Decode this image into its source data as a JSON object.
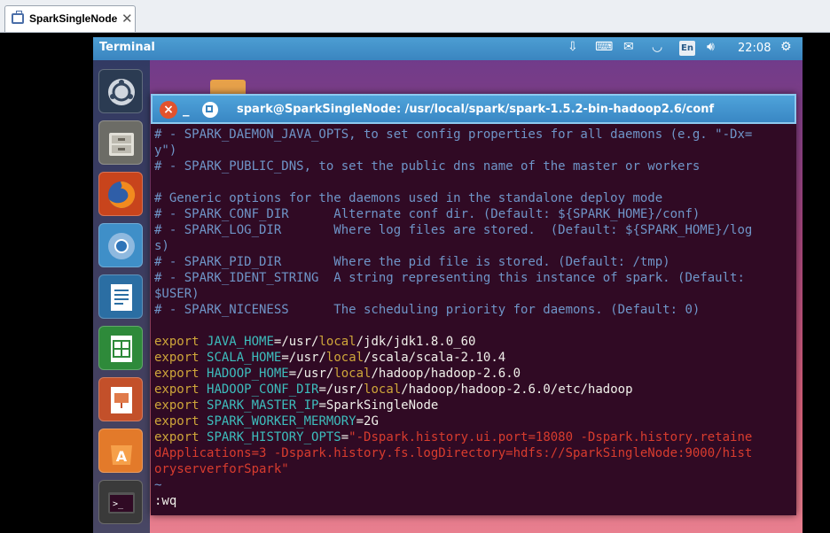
{
  "host": {
    "tab_title": "SparkSingleNode",
    "tab_close": "✕"
  },
  "topbar": {
    "app_title": "Terminal",
    "language": "En",
    "clock": "22:08"
  },
  "launcher": {
    "items": [
      {
        "icon": "ubuntu-dash-icon"
      },
      {
        "icon": "file-manager-icon"
      },
      {
        "icon": "firefox-icon"
      },
      {
        "icon": "chromium-icon"
      },
      {
        "icon": "libreoffice-writer-icon"
      },
      {
        "icon": "libreoffice-calc-icon"
      },
      {
        "icon": "libreoffice-impress-icon"
      },
      {
        "icon": "software-center-icon"
      },
      {
        "icon": "terminal-icon"
      }
    ]
  },
  "terminal": {
    "title": "spark@SparkSingleNode: /usr/local/spark/spark-1.5.2-bin-hadoop2.6/conf",
    "lines": [
      {
        "c": "# - SPARK_DAEMON_JAVA_OPTS, to set config properties for all daemons (e.g. \"-Dx=",
        "cls": "com"
      },
      {
        "c": "y\")",
        "cls": "com"
      },
      {
        "c": "# - SPARK_PUBLIC_DNS, to set the public dns name of the master or workers",
        "cls": "com"
      },
      {
        "c": "",
        "cls": "com"
      },
      {
        "c": "# Generic options for the daemons used in the standalone deploy mode",
        "cls": "com"
      },
      {
        "c": "# - SPARK_CONF_DIR      Alternate conf dir. (Default: ${SPARK_HOME}/conf)",
        "cls": "com"
      },
      {
        "c": "# - SPARK_LOG_DIR       Where log files are stored.  (Default: ${SPARK_HOME}/log",
        "cls": "com"
      },
      {
        "c": "s)",
        "cls": "com"
      },
      {
        "c": "# - SPARK_PID_DIR       Where the pid file is stored. (Default: /tmp)",
        "cls": "com"
      },
      {
        "c": "# - SPARK_IDENT_STRING  A string representing this instance of spark. (Default:",
        "cls": "com"
      },
      {
        "c": "$USER)",
        "cls": "com"
      },
      {
        "c": "# - SPARK_NICENESS      The scheduling priority for daemons. (Default: 0)",
        "cls": "com"
      },
      {
        "c": "",
        "cls": "com"
      }
    ],
    "exports": [
      {
        "kw": "export",
        "var": "JAVA_HOME",
        "eq": "=",
        "val": [
          [
            "/usr/",
            "txt"
          ],
          [
            "local",
            "kw"
          ],
          [
            "/jdk/jdk1.8.0_60",
            "txt"
          ]
        ]
      },
      {
        "kw": "export",
        "var": "SCALA_HOME",
        "eq": "=",
        "val": [
          [
            "/usr/",
            "txt"
          ],
          [
            "local",
            "kw"
          ],
          [
            "/scala/scala-2.10.4",
            "txt"
          ]
        ]
      },
      {
        "kw": "export",
        "var": "HADOOP_HOME",
        "eq": "=",
        "val": [
          [
            "/usr/",
            "txt"
          ],
          [
            "local",
            "kw"
          ],
          [
            "/hadoop/hadoop-2.6.0",
            "txt"
          ]
        ]
      },
      {
        "kw": "export",
        "var": "HADOOP_CONF_DIR",
        "eq": "=",
        "val": [
          [
            "/usr/",
            "txt"
          ],
          [
            "local",
            "kw"
          ],
          [
            "/hadoop/hadoop-2.6.0/etc/hadoop",
            "txt"
          ]
        ]
      },
      {
        "kw": "export",
        "var": "SPARK_MASTER_IP",
        "eq": "=",
        "val": [
          [
            "SparkSingleNode",
            "txt"
          ]
        ]
      },
      {
        "kw": "export",
        "var": "SPARK_WORKER_MERMORY",
        "eq": "=",
        "val": [
          [
            "2G",
            "txt"
          ]
        ]
      },
      {
        "kw": "export",
        "var": "SPARK_HISTORY_OPTS",
        "eq": "=",
        "val": [
          [
            "\"",
            "str"
          ],
          [
            "-Dspark.history.ui.port=18080 -Dspark.history.retaine",
            "str"
          ]
        ]
      }
    ],
    "wrapped": [
      "dApplications=3 -Dspark.history.fs.logDirectory=hdfs://SparkSingleNode:9000/hist",
      "oryserverforSpark\""
    ],
    "tilde": "~",
    "command": ":wq"
  }
}
